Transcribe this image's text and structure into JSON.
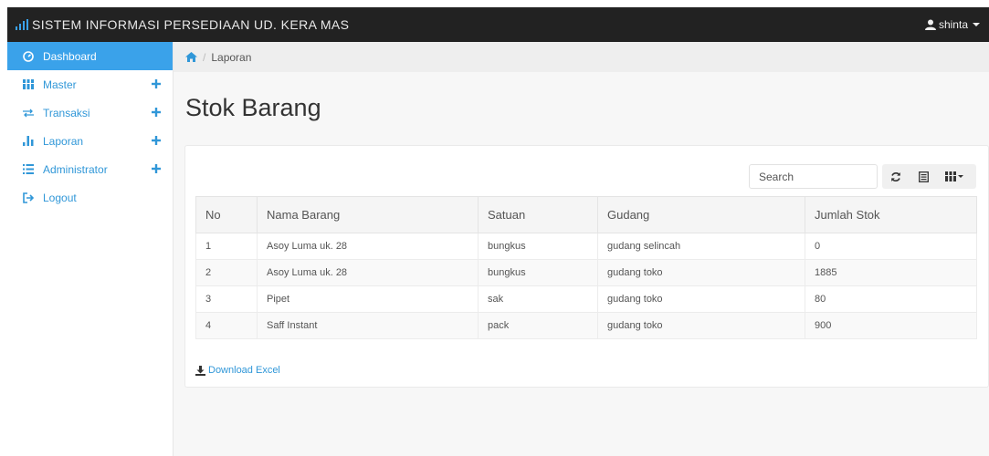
{
  "app": {
    "title": "SISTEM INFORMASI PERSEDIAAN UD. KERA MAS",
    "user_name": "shinta"
  },
  "sidebar": {
    "items": [
      {
        "label": "Dashboard",
        "icon": "dashboard-icon",
        "active": true,
        "expandable": false
      },
      {
        "label": "Master",
        "icon": "grid-icon",
        "active": false,
        "expandable": true
      },
      {
        "label": "Transaksi",
        "icon": "exchange-icon",
        "active": false,
        "expandable": true
      },
      {
        "label": "Laporan",
        "icon": "bar-chart-icon",
        "active": false,
        "expandable": true
      },
      {
        "label": "Administrator",
        "icon": "list-icon",
        "active": false,
        "expandable": true
      },
      {
        "label": "Logout",
        "icon": "logout-icon",
        "active": false,
        "expandable": false
      }
    ]
  },
  "breadcrumb": {
    "home_icon": "home-icon",
    "current": "Laporan"
  },
  "page": {
    "title": "Stok Barang"
  },
  "toolbar": {
    "search_placeholder": "Search",
    "refresh_icon": "refresh-icon",
    "toggle_icon": "list-view-icon",
    "columns_icon": "columns-icon"
  },
  "table": {
    "columns": [
      "No",
      "Nama Barang",
      "Satuan",
      "Gudang",
      "Jumlah Stok"
    ],
    "rows": [
      [
        "1",
        "Asoy Luma uk. 28",
        "bungkus",
        "gudang selincah",
        "0"
      ],
      [
        "2",
        "Asoy Luma uk. 28",
        "bungkus",
        "gudang toko",
        "1885"
      ],
      [
        "3",
        "Pipet",
        "sak",
        "gudang toko",
        "80"
      ],
      [
        "4",
        "Saff Instant",
        "pack",
        "gudang toko",
        "900"
      ]
    ]
  },
  "footer": {
    "download_label": "Download Excel",
    "download_icon": "download-icon"
  },
  "colors": {
    "topbar": "#222222",
    "accent": "#3aa2ea",
    "link": "#3097d8"
  }
}
